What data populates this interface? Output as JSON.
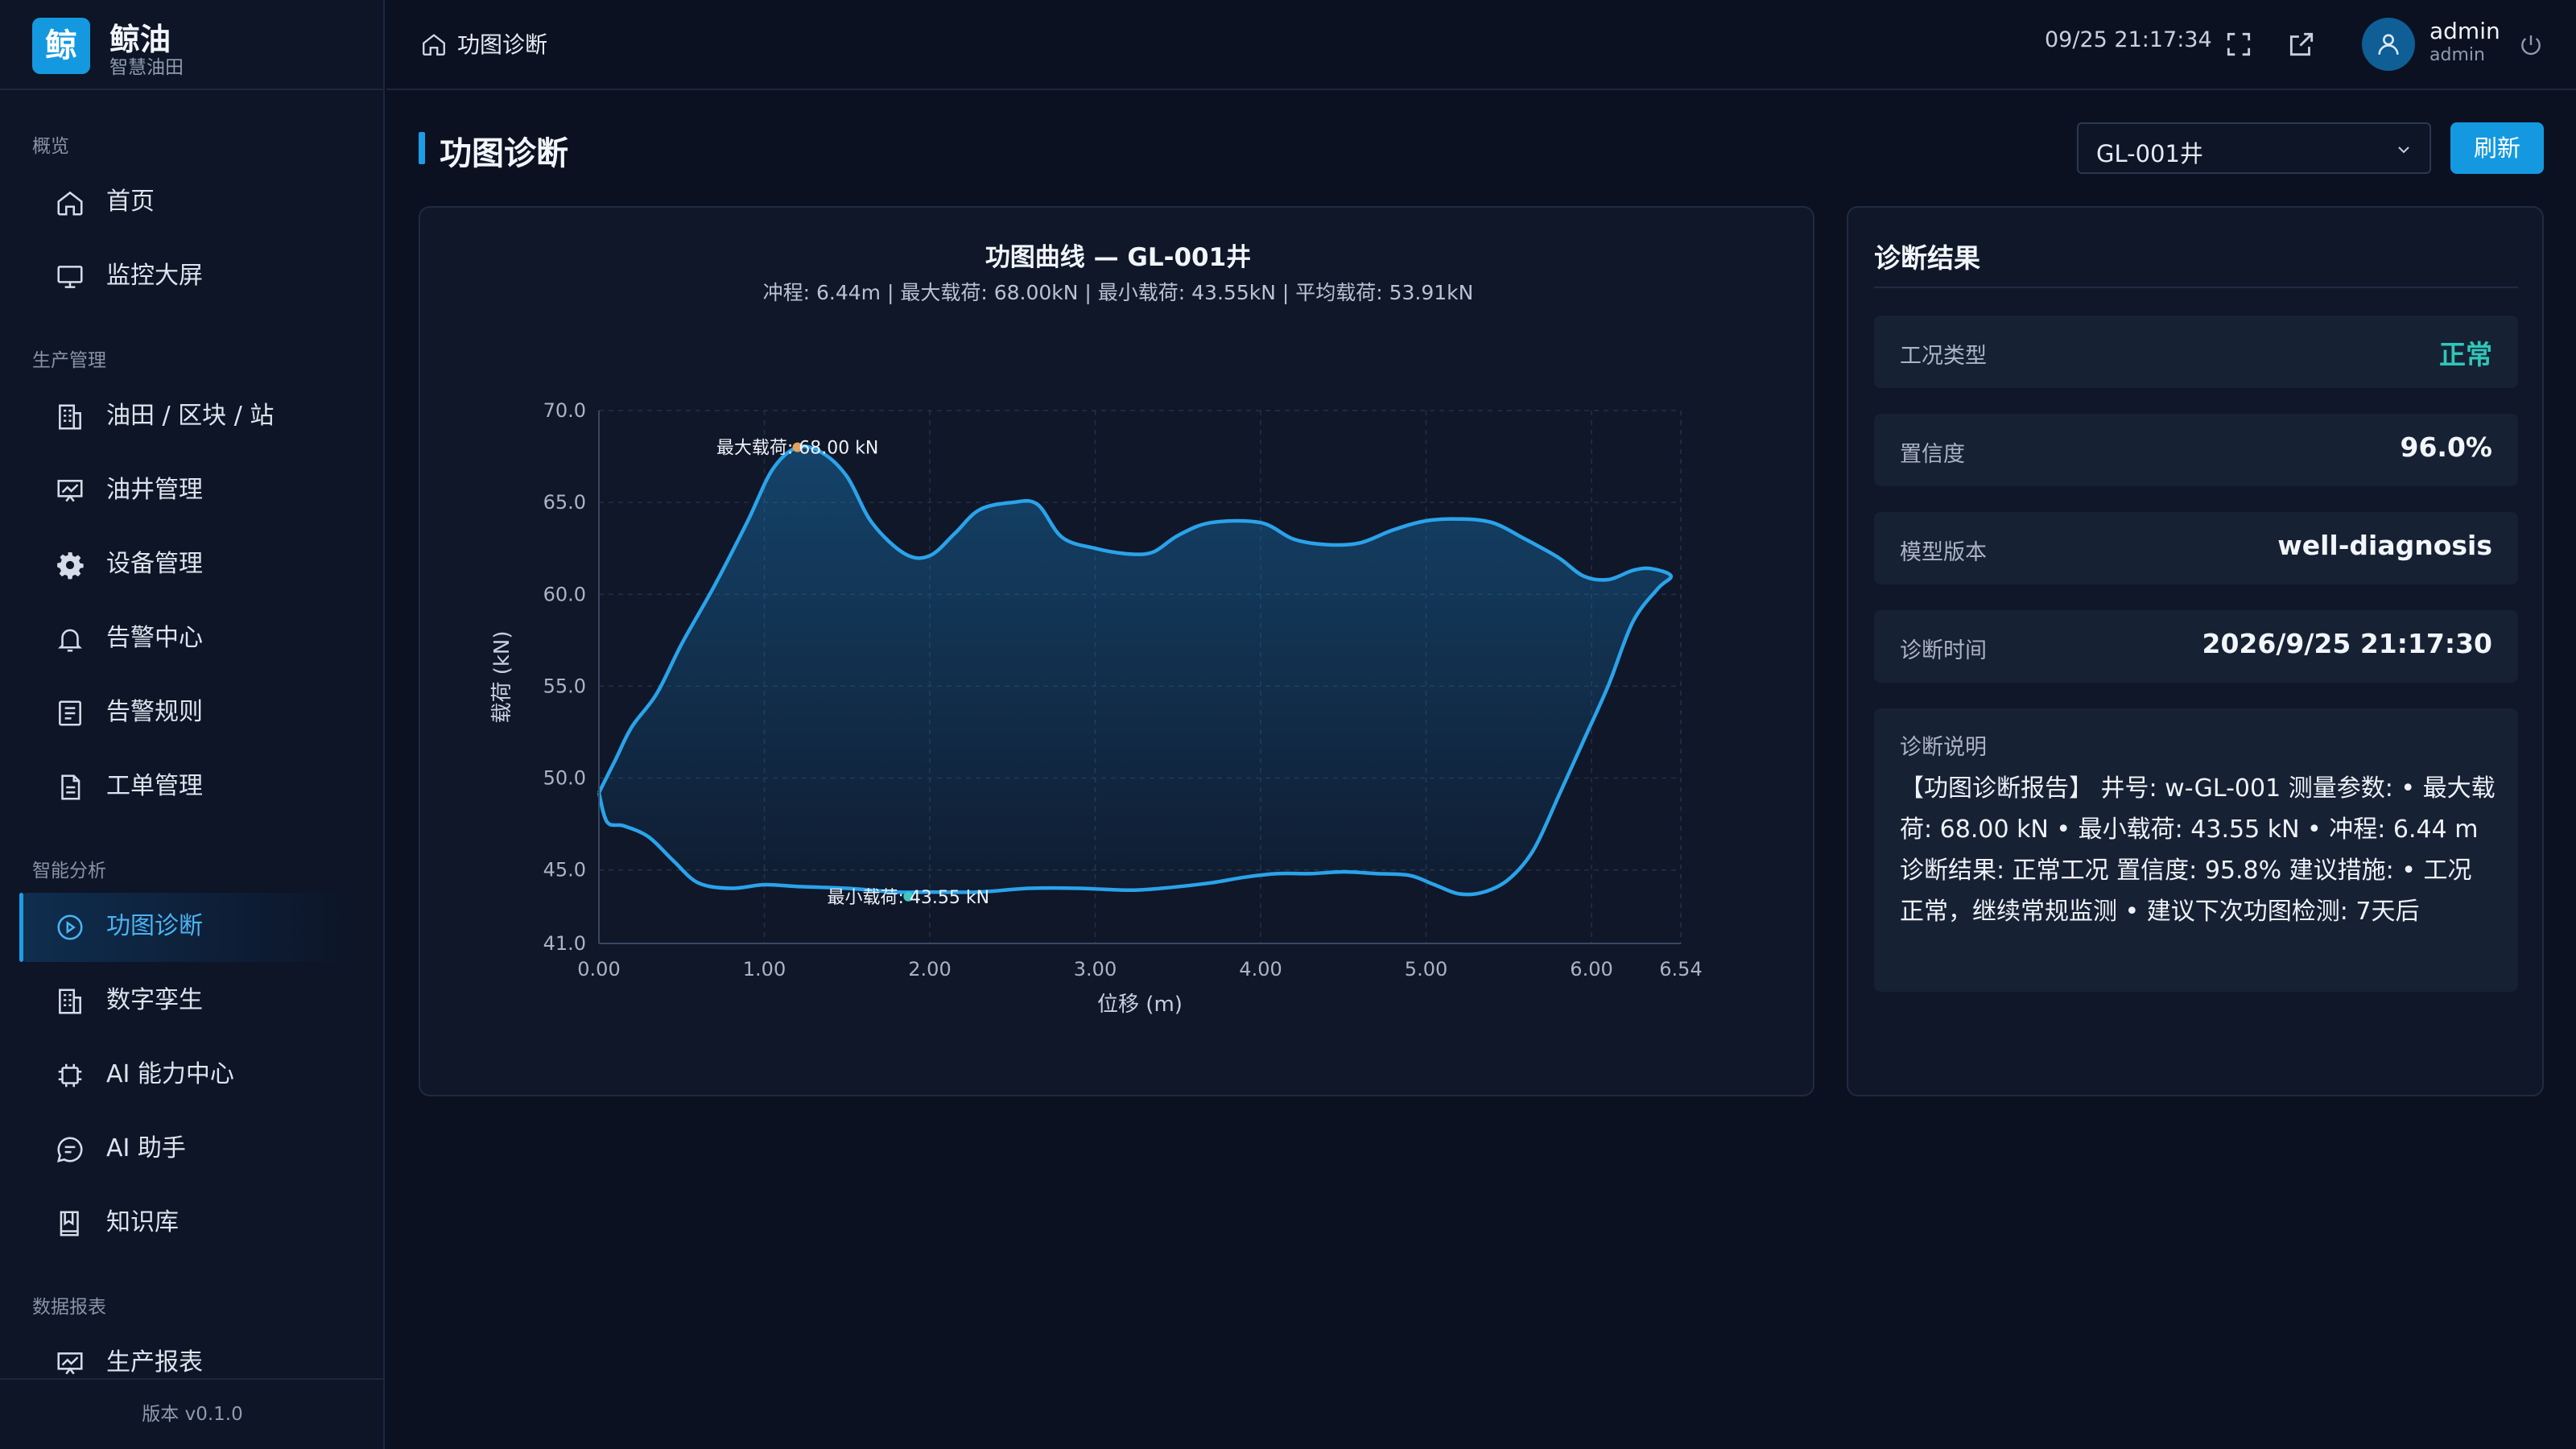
{
  "brand": {
    "logo_char": "鲸",
    "name": "鲸油",
    "subtitle": "智慧油田"
  },
  "sidebar": {
    "sections": [
      {
        "title": "概览"
      },
      {
        "title": "生产管理"
      },
      {
        "title": "智能分析"
      },
      {
        "title": "数据报表"
      }
    ],
    "items": [
      {
        "label": "首页",
        "icon": "home-icon"
      },
      {
        "label": "监控大屏",
        "icon": "monitor-icon"
      },
      {
        "label": "油田 / 区块 / 站",
        "icon": "building-icon"
      },
      {
        "label": "油井管理",
        "icon": "well-icon"
      },
      {
        "label": "设备管理",
        "icon": "gear-icon"
      },
      {
        "label": "告警中心",
        "icon": "bell-icon"
      },
      {
        "label": "告警规则",
        "icon": "rules-icon"
      },
      {
        "label": "工单管理",
        "icon": "document-icon"
      },
      {
        "label": "功图诊断",
        "icon": "play-circle-icon",
        "active": true
      },
      {
        "label": "数字孪生",
        "icon": "building-icon"
      },
      {
        "label": "AI 能力中心",
        "icon": "chip-icon"
      },
      {
        "label": "AI 助手",
        "icon": "chat-icon"
      },
      {
        "label": "知识库",
        "icon": "book-icon"
      },
      {
        "label": "生产报表",
        "icon": "presentation-icon"
      }
    ],
    "version": "版本 v0.1.0"
  },
  "topbar": {
    "breadcrumb": "功图诊断",
    "datetime": "09/25 21:17:34",
    "user_name": "admin",
    "user_role": "admin"
  },
  "page": {
    "title": "功图诊断",
    "well_select_value": "GL-001井",
    "refresh_label": "刷新"
  },
  "chart_data": {
    "type": "line",
    "title": "功图曲线 — GL-001井",
    "subtitle": "冲程: 6.44m | 最大载荷: 68.00kN | 最小载荷: 43.55kN | 平均载荷: 53.91kN",
    "xlabel": "位移 (m)",
    "ylabel": "载荷 (kN)",
    "xlim": [
      0,
      6.54
    ],
    "ylim": [
      41,
      70
    ],
    "x_ticks": [
      "0.00",
      "1.00",
      "2.00",
      "3.00",
      "4.00",
      "5.00",
      "6.00",
      "6.54"
    ],
    "y_ticks": [
      "70.0",
      "65.0",
      "60.0",
      "55.0",
      "50.0",
      "45.0",
      "41.0"
    ],
    "grid": true,
    "series": [
      {
        "values_upper": [
          [
            0.0,
            49.2
          ],
          [
            0.1,
            51.0
          ],
          [
            0.2,
            52.8
          ],
          [
            0.35,
            54.6
          ],
          [
            0.5,
            57.3
          ],
          [
            0.7,
            60.5
          ],
          [
            0.9,
            64.0
          ],
          [
            1.05,
            66.8
          ],
          [
            1.2,
            68.0
          ],
          [
            1.35,
            67.7
          ],
          [
            1.5,
            66.4
          ],
          [
            1.65,
            63.9
          ],
          [
            1.85,
            62.2
          ],
          [
            2.0,
            62.1
          ],
          [
            2.15,
            63.3
          ],
          [
            2.3,
            64.6
          ],
          [
            2.5,
            65.0
          ],
          [
            2.65,
            64.9
          ],
          [
            2.8,
            63.1
          ],
          [
            3.0,
            62.5
          ],
          [
            3.2,
            62.2
          ],
          [
            3.35,
            62.3
          ],
          [
            3.5,
            63.2
          ],
          [
            3.7,
            63.9
          ],
          [
            4.0,
            63.9
          ],
          [
            4.2,
            63.0
          ],
          [
            4.4,
            62.7
          ],
          [
            4.6,
            62.8
          ],
          [
            4.8,
            63.5
          ],
          [
            5.0,
            64.0
          ],
          [
            5.2,
            64.1
          ],
          [
            5.4,
            63.9
          ],
          [
            5.6,
            63.0
          ],
          [
            5.8,
            62.0
          ],
          [
            5.95,
            61.0
          ],
          [
            6.1,
            60.8
          ],
          [
            6.25,
            61.3
          ],
          [
            6.36,
            61.4
          ]
        ],
        "values_lower": [
          [
            6.48,
            61.0
          ],
          [
            6.4,
            60.3
          ],
          [
            6.25,
            58.5
          ],
          [
            6.1,
            55.0
          ],
          [
            5.95,
            52.0
          ],
          [
            5.8,
            49.0
          ],
          [
            5.65,
            46.1
          ],
          [
            5.5,
            44.5
          ],
          [
            5.35,
            43.8
          ],
          [
            5.2,
            43.7
          ],
          [
            5.05,
            44.2
          ],
          [
            4.9,
            44.7
          ],
          [
            4.7,
            44.8
          ],
          [
            4.5,
            44.9
          ],
          [
            4.3,
            44.8
          ],
          [
            4.1,
            44.8
          ],
          [
            3.9,
            44.6
          ],
          [
            3.7,
            44.3
          ],
          [
            3.4,
            44.0
          ],
          [
            3.2,
            43.9
          ],
          [
            2.9,
            44.0
          ],
          [
            2.6,
            44.0
          ],
          [
            2.3,
            43.8
          ],
          [
            2.0,
            43.8
          ],
          [
            1.8,
            43.8
          ],
          [
            1.5,
            44.0
          ],
          [
            1.2,
            44.1
          ],
          [
            1.0,
            44.2
          ],
          [
            0.8,
            44.0
          ],
          [
            0.6,
            44.3
          ],
          [
            0.45,
            45.5
          ],
          [
            0.3,
            46.8
          ],
          [
            0.15,
            47.4
          ],
          [
            0.05,
            47.6
          ],
          [
            0.0,
            49.2
          ]
        ]
      }
    ],
    "annotations": [
      {
        "text": "最大载荷: 68.00 kN",
        "x": 1.2,
        "y": 68.0,
        "dot_color": "#e0a25c"
      },
      {
        "text": "最小载荷: 43.55 kN",
        "x": 1.87,
        "y": 43.55,
        "dot_color": "#3fc8c0"
      }
    ],
    "line_color": "#2aa3ea"
  },
  "diagnosis": {
    "title": "诊断结果",
    "rows": [
      {
        "key": "工况类型",
        "value": "正常",
        "status_color": "#2fc7b8"
      },
      {
        "key": "置信度",
        "value": "96.0%"
      },
      {
        "key": "模型版本",
        "value": "well-diagnosis"
      },
      {
        "key": "诊断时间",
        "value": "2026/9/25 21:17:30"
      }
    ],
    "note_label": "诊断说明",
    "note_text": "【功图诊断报告】 井号: w-GL-001 测量参数: • 最大载荷: 68.00 kN • 最小载荷: 43.55 kN • 冲程: 6.44 m 诊断结果: 正常工况 置信度: 95.8% 建议措施: • 工况正常，继续常规监测 • 建议下次功图检测: 7天后"
  }
}
